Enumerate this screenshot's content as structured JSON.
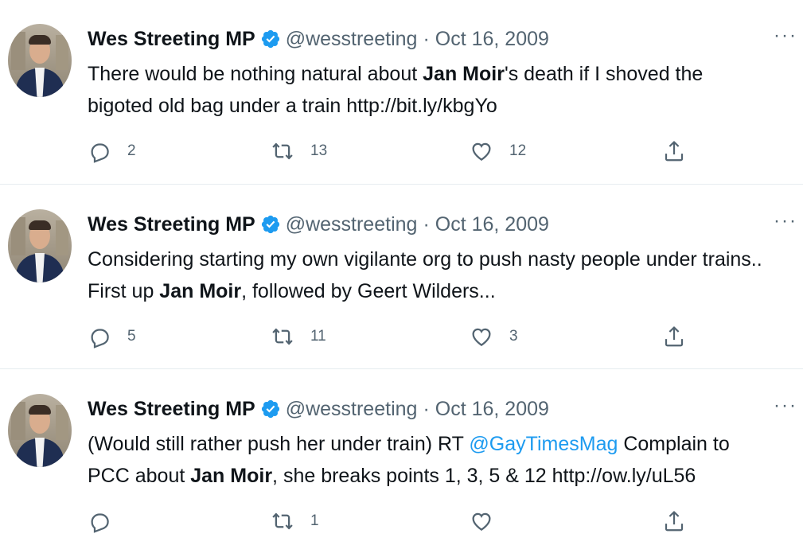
{
  "tweets": [
    {
      "author": "Wes Streeting MP",
      "handle": "@wesstreeting",
      "separator": "·",
      "date": "Oct 16, 2009",
      "text_parts": {
        "p1": "There would be nothing natural about ",
        "b1": "Jan Moir",
        "p2": "'s death if I shoved the",
        "p3": "bigoted old bag under a train http://bit.ly/kbgYo"
      },
      "replies": "2",
      "retweets": "13",
      "likes": "12"
    },
    {
      "author": "Wes Streeting MP",
      "handle": "@wesstreeting",
      "separator": "·",
      "date": "Oct 16, 2009",
      "text_parts": {
        "p1": "Considering starting my own vigilante org to push nasty people under trains..",
        "p2": "First up ",
        "b1": "Jan Moir",
        "p3": ", followed by Geert Wilders..."
      },
      "replies": "5",
      "retweets": "11",
      "likes": "3"
    },
    {
      "author": "Wes Streeting MP",
      "handle": "@wesstreeting",
      "separator": "·",
      "date": "Oct 16, 2009",
      "text_parts": {
        "p1": "(Would still rather push her under train) RT ",
        "mention": "@GayTimesMag",
        "p2": " Complain to",
        "p3": "PCC about ",
        "b1": "Jan Moir",
        "p4": ", she breaks points 1, 3, 5 & 12 http://ow.ly/uL56"
      },
      "replies": "",
      "retweets": "1",
      "likes": ""
    }
  ],
  "more_label": "···",
  "colors": {
    "text": "#0f1419",
    "secondary": "#536471",
    "link": "#1d9bf0",
    "verified": "#1d9bf0",
    "divider": "#e6ecf0"
  },
  "icons": [
    "reply-icon",
    "retweet-icon",
    "like-icon",
    "share-icon",
    "verified-badge-icon",
    "more-icon"
  ]
}
